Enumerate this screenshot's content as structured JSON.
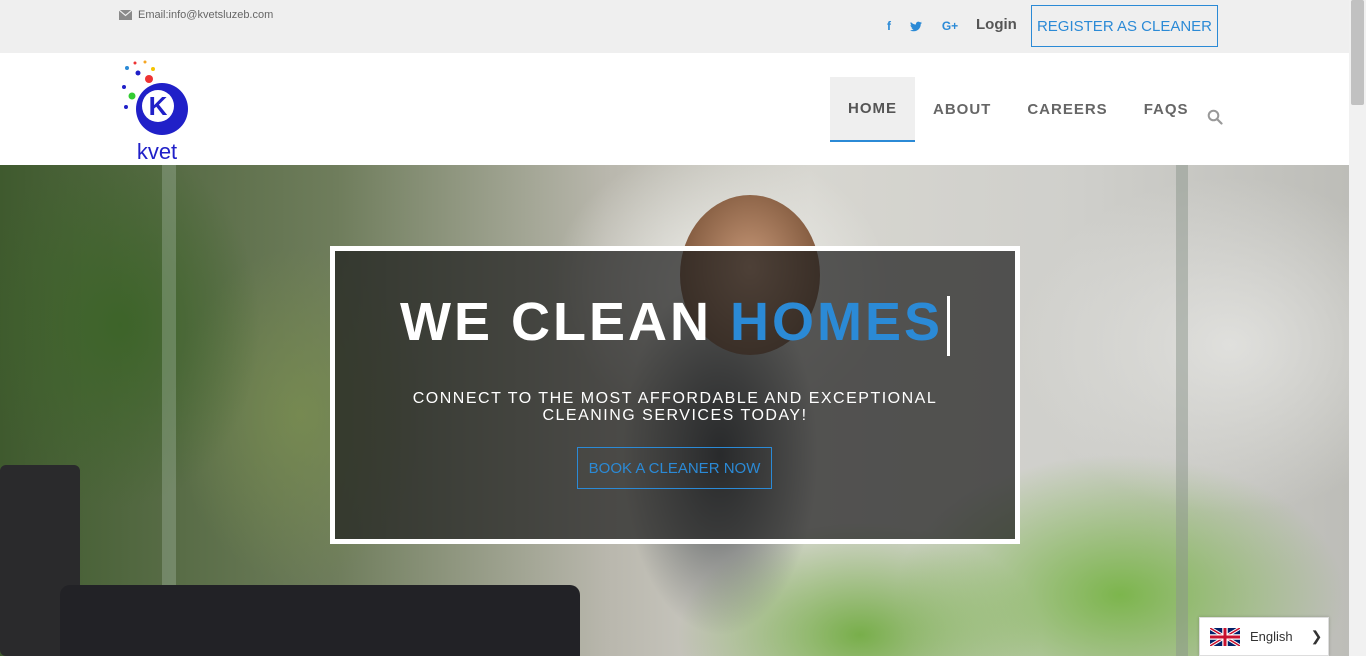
{
  "topbar": {
    "email": "Email:info@kvetsluzeb.com",
    "social": [
      "f",
      "t",
      "G+"
    ],
    "login": "Login",
    "register": "REGISTER AS CLEANER"
  },
  "header": {
    "logo_text": "kvet",
    "logo_letter": "K",
    "nav": [
      "HOME",
      "ABOUT",
      "CAREERS",
      "FAQS"
    ]
  },
  "hero": {
    "title_main": "WE CLEAN ",
    "title_accent": "HOMES",
    "subtitle_line1": "CONNECT TO THE MOST AFFORDABLE AND EXCEPTIONAL",
    "subtitle_line2": "CLEANING SERVICES TODAY!",
    "cta": "BOOK A CLEANER NOW"
  },
  "language": {
    "current": "English"
  },
  "colors": {
    "accent": "#2b8ad6",
    "topbar_bg": "#efefef",
    "logo_blue": "#2020c8"
  }
}
